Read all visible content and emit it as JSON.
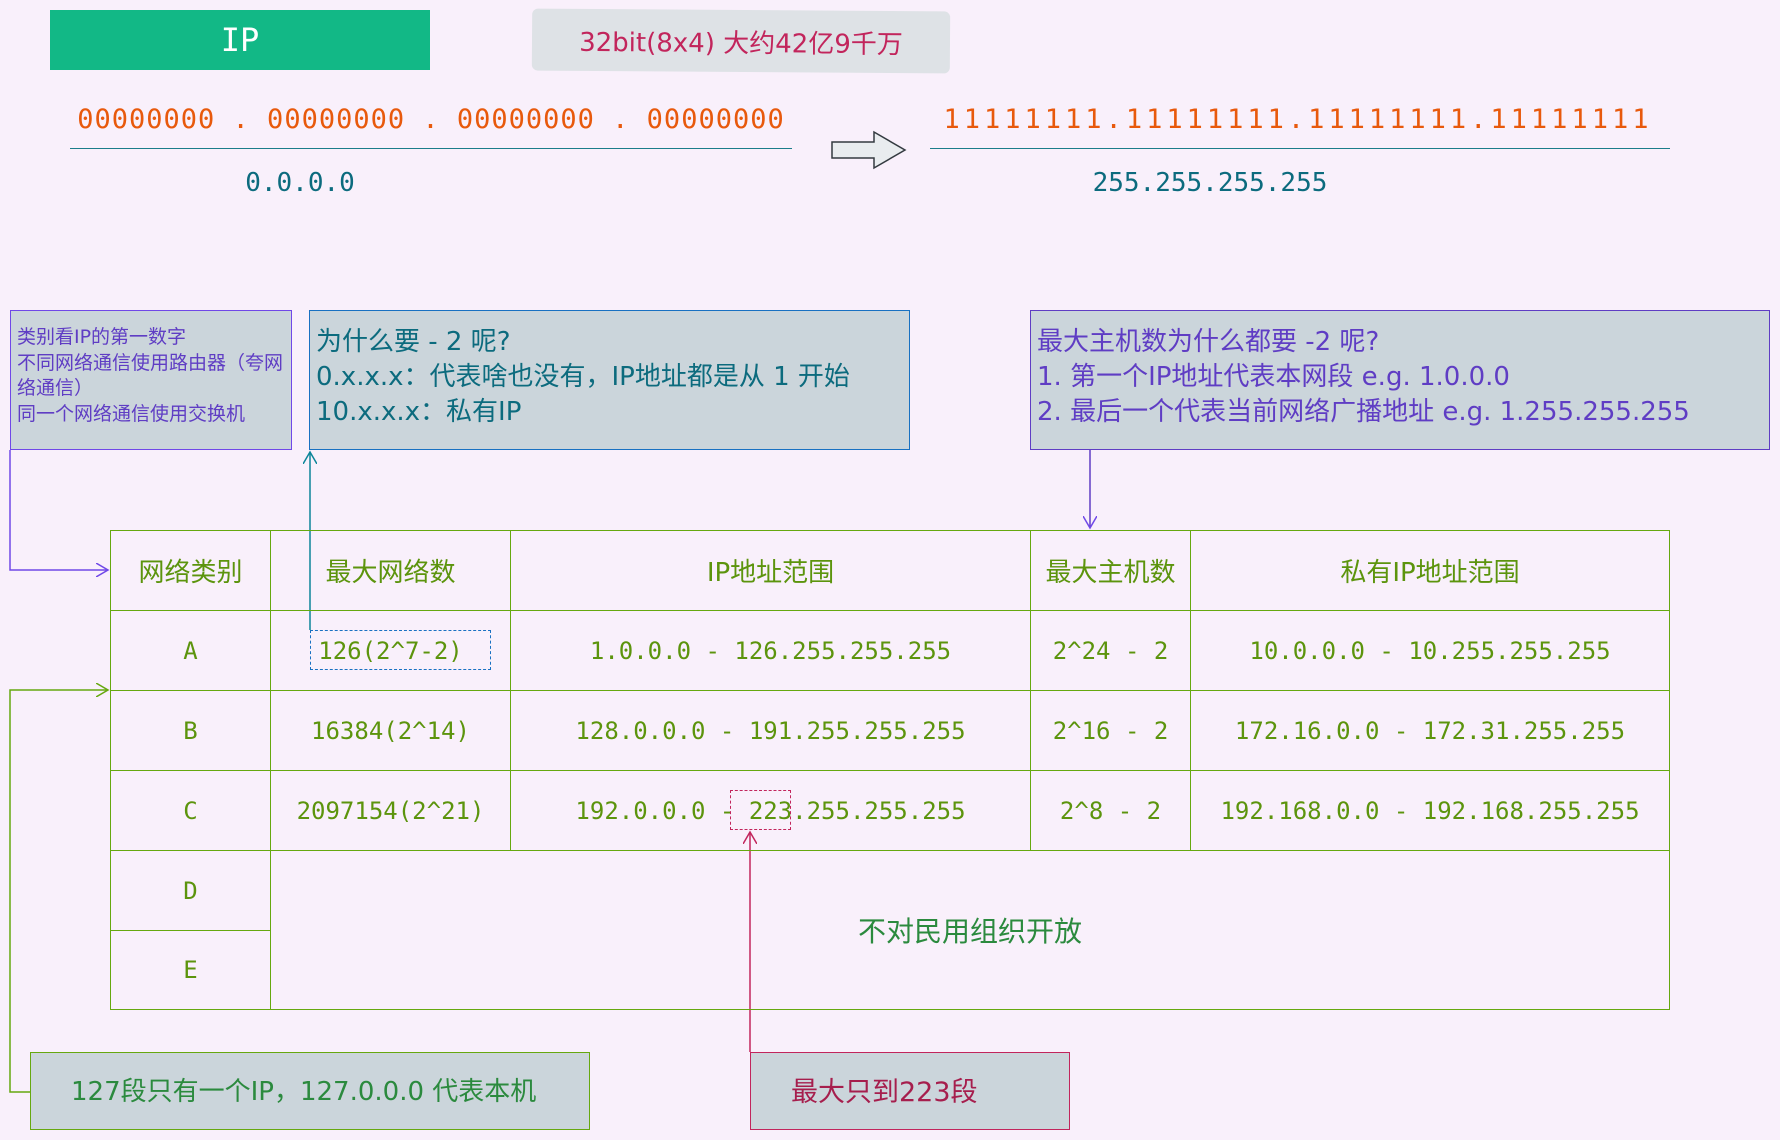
{
  "title_box": {
    "label": "IP"
  },
  "bits_note": {
    "text": "32bit(8x4) 大约42亿9千万"
  },
  "range_demo": {
    "min_binary": "00000000 . 00000000 . 00000000 . 00000000",
    "min_dotted": "0.0.0.0",
    "max_binary": "11111111.11111111.11111111.11111111",
    "max_dotted": "255.255.255.255"
  },
  "notes": {
    "category": [
      "类别看IP的第一数字",
      "不同网络通信使用路由器（夸网络通信）",
      "同一个网络通信使用交换机"
    ],
    "why_minus_2": [
      "为什么要 - 2 呢?",
      "0.x.x.x：代表啥也没有，IP地址都是从 1 开始",
      "10.x.x.x：私有IP"
    ],
    "max_hosts": [
      "最大主机数为什么都要 -2 呢?",
      "1. 第一个IP地址代表本网段 e.g. 1.0.0.0",
      "2. 最后一个代表当前网络广播地址 e.g. 1.255.255.255"
    ],
    "loopback": "127段只有一个IP，127.0.0.0 代表本机",
    "max_223": "最大只到223段"
  },
  "table": {
    "headers": [
      "网络类别",
      "最大网络数",
      "IP地址范围",
      "最大主机数",
      "私有IP地址范围"
    ],
    "rows": [
      [
        "A",
        "126(2^7-2)",
        "1.0.0.0 - 126.255.255.255",
        "2^24 - 2",
        "10.0.0.0 - 10.255.255.255"
      ],
      [
        "B",
        "16384(2^14)",
        "128.0.0.0 - 191.255.255.255",
        "2^16 - 2",
        "172.16.0.0 - 172.31.255.255"
      ],
      [
        "C",
        "2097154(2^21)",
        "192.0.0.0 - 223.255.255.255",
        "2^8 - 2",
        "192.168.0.0 - 192.168.255.255"
      ]
    ],
    "class_d": "D",
    "class_e": "E",
    "de_note": "不对民用组织开放"
  },
  "colors": {
    "title_bg": "#12b886",
    "note_bg": "#cbd5db",
    "table_border": "#66a80f",
    "binary_text": "#e8590c",
    "highlight_red": "#c2255c"
  }
}
